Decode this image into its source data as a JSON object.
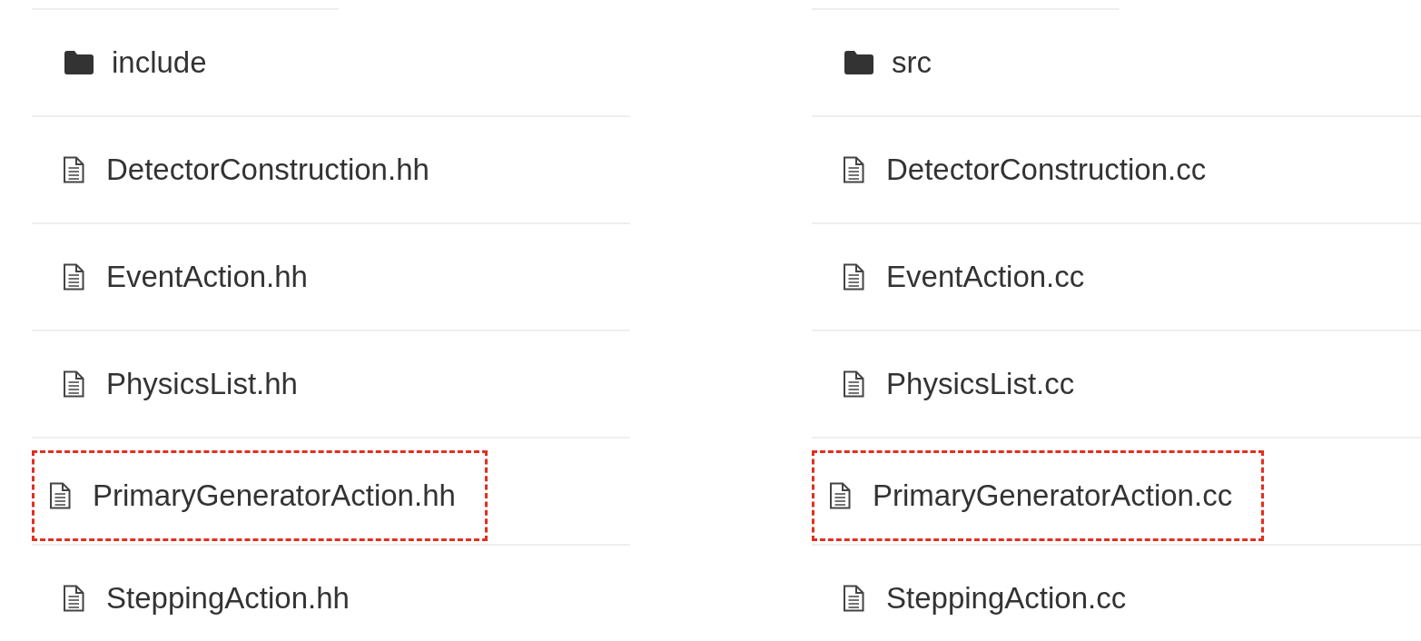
{
  "columns": [
    {
      "folder": "include",
      "files": [
        {
          "name": "DetectorConstruction.hh",
          "marked": false
        },
        {
          "name": "EventAction.hh",
          "marked": false
        },
        {
          "name": "PhysicsList.hh",
          "marked": false
        },
        {
          "name": "PrimaryGeneratorAction.hh",
          "marked": true
        },
        {
          "name": "SteppingAction.hh",
          "marked": false
        }
      ]
    },
    {
      "folder": "src",
      "files": [
        {
          "name": "DetectorConstruction.cc",
          "marked": false
        },
        {
          "name": "EventAction.cc",
          "marked": false
        },
        {
          "name": "PhysicsList.cc",
          "marked": false
        },
        {
          "name": "PrimaryGeneratorAction.cc",
          "marked": true
        },
        {
          "name": "SteppingAction.cc",
          "marked": false
        }
      ]
    }
  ]
}
